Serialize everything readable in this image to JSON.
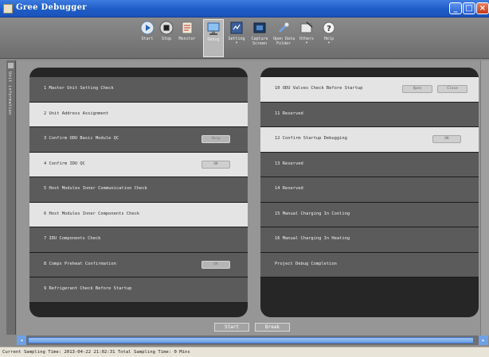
{
  "window": {
    "title": "Gree Debugger",
    "min_label": "_",
    "max_label": "□",
    "close_label": "×"
  },
  "toolbar": {
    "items": [
      {
        "label": "Start",
        "icon": "play-icon",
        "dropdown": false
      },
      {
        "label": "Stop",
        "icon": "stop-icon",
        "dropdown": false
      },
      {
        "label": "Monitor",
        "icon": "monitor-icon",
        "dropdown": false
      },
      {
        "label": "Debug",
        "icon": "debug-icon",
        "dropdown": false,
        "active": true
      },
      {
        "label": "Setting",
        "icon": "setting-icon",
        "dropdown": true
      },
      {
        "label": "Capture\nScreen",
        "icon": "capture-screen-icon",
        "dropdown": false
      },
      {
        "label": "Open Data\nFolder",
        "icon": "open-folder-icon",
        "dropdown": false
      },
      {
        "label": "Others",
        "icon": "others-icon",
        "dropdown": true
      },
      {
        "label": "Help",
        "icon": "help-icon",
        "dropdown": true
      }
    ]
  },
  "sidetab": {
    "label": "Unit information"
  },
  "left_steps": [
    {
      "label": "1 Master Unit Setting Check",
      "tone": "dark",
      "buttons": []
    },
    {
      "label": "2 Unit Address Assignment",
      "tone": "light",
      "buttons": []
    },
    {
      "label": "3 Confirm ODU Basic Module QC",
      "tone": "dark",
      "buttons": [
        "Skip"
      ]
    },
    {
      "label": "4 Confirm IDU QC",
      "tone": "light",
      "buttons": [
        "OK"
      ]
    },
    {
      "label": "5 Host Modules Inner Communication Check",
      "tone": "dark",
      "buttons": []
    },
    {
      "label": "6 Host Modules Inner Components Check",
      "tone": "light",
      "buttons": []
    },
    {
      "label": "7 IDU Components Check",
      "tone": "dark",
      "buttons": []
    },
    {
      "label": "8 Comps Preheat Confirmation",
      "tone": "dark",
      "buttons": [
        "OK"
      ]
    },
    {
      "label": "9 Refrigerant Check Before Startup",
      "tone": "dark",
      "buttons": []
    }
  ],
  "right_steps": [
    {
      "label": "10 ODU Valves Check Before Startup",
      "tone": "light",
      "buttons": [
        "Open",
        "Close"
      ]
    },
    {
      "label": "11 Reserved",
      "tone": "dark",
      "buttons": []
    },
    {
      "label": "12 Confirm Startup Debugging",
      "tone": "light",
      "buttons": [
        "OK"
      ]
    },
    {
      "label": "13 Reserved",
      "tone": "dark",
      "buttons": []
    },
    {
      "label": "14 Reserved",
      "tone": "dark",
      "buttons": []
    },
    {
      "label": "15 Manual Charging In Cooling",
      "tone": "dark",
      "buttons": []
    },
    {
      "label": "16 Manual Charging In Heating",
      "tone": "dark",
      "buttons": []
    },
    {
      "label": "Project Debug Completion",
      "tone": "dark",
      "buttons": []
    }
  ],
  "actions": {
    "start_label": "Start",
    "break_label": "Break"
  },
  "status": {
    "text": "Current Sampling Time: 2013-04-22 21:02:31  Total Sampling Time: 0 Mins"
  },
  "colors": {
    "title_bar": "#1f5cc7",
    "panel_bg": "#262626",
    "row_dark": "#5b5b5b",
    "row_light": "#e4e4e4"
  }
}
